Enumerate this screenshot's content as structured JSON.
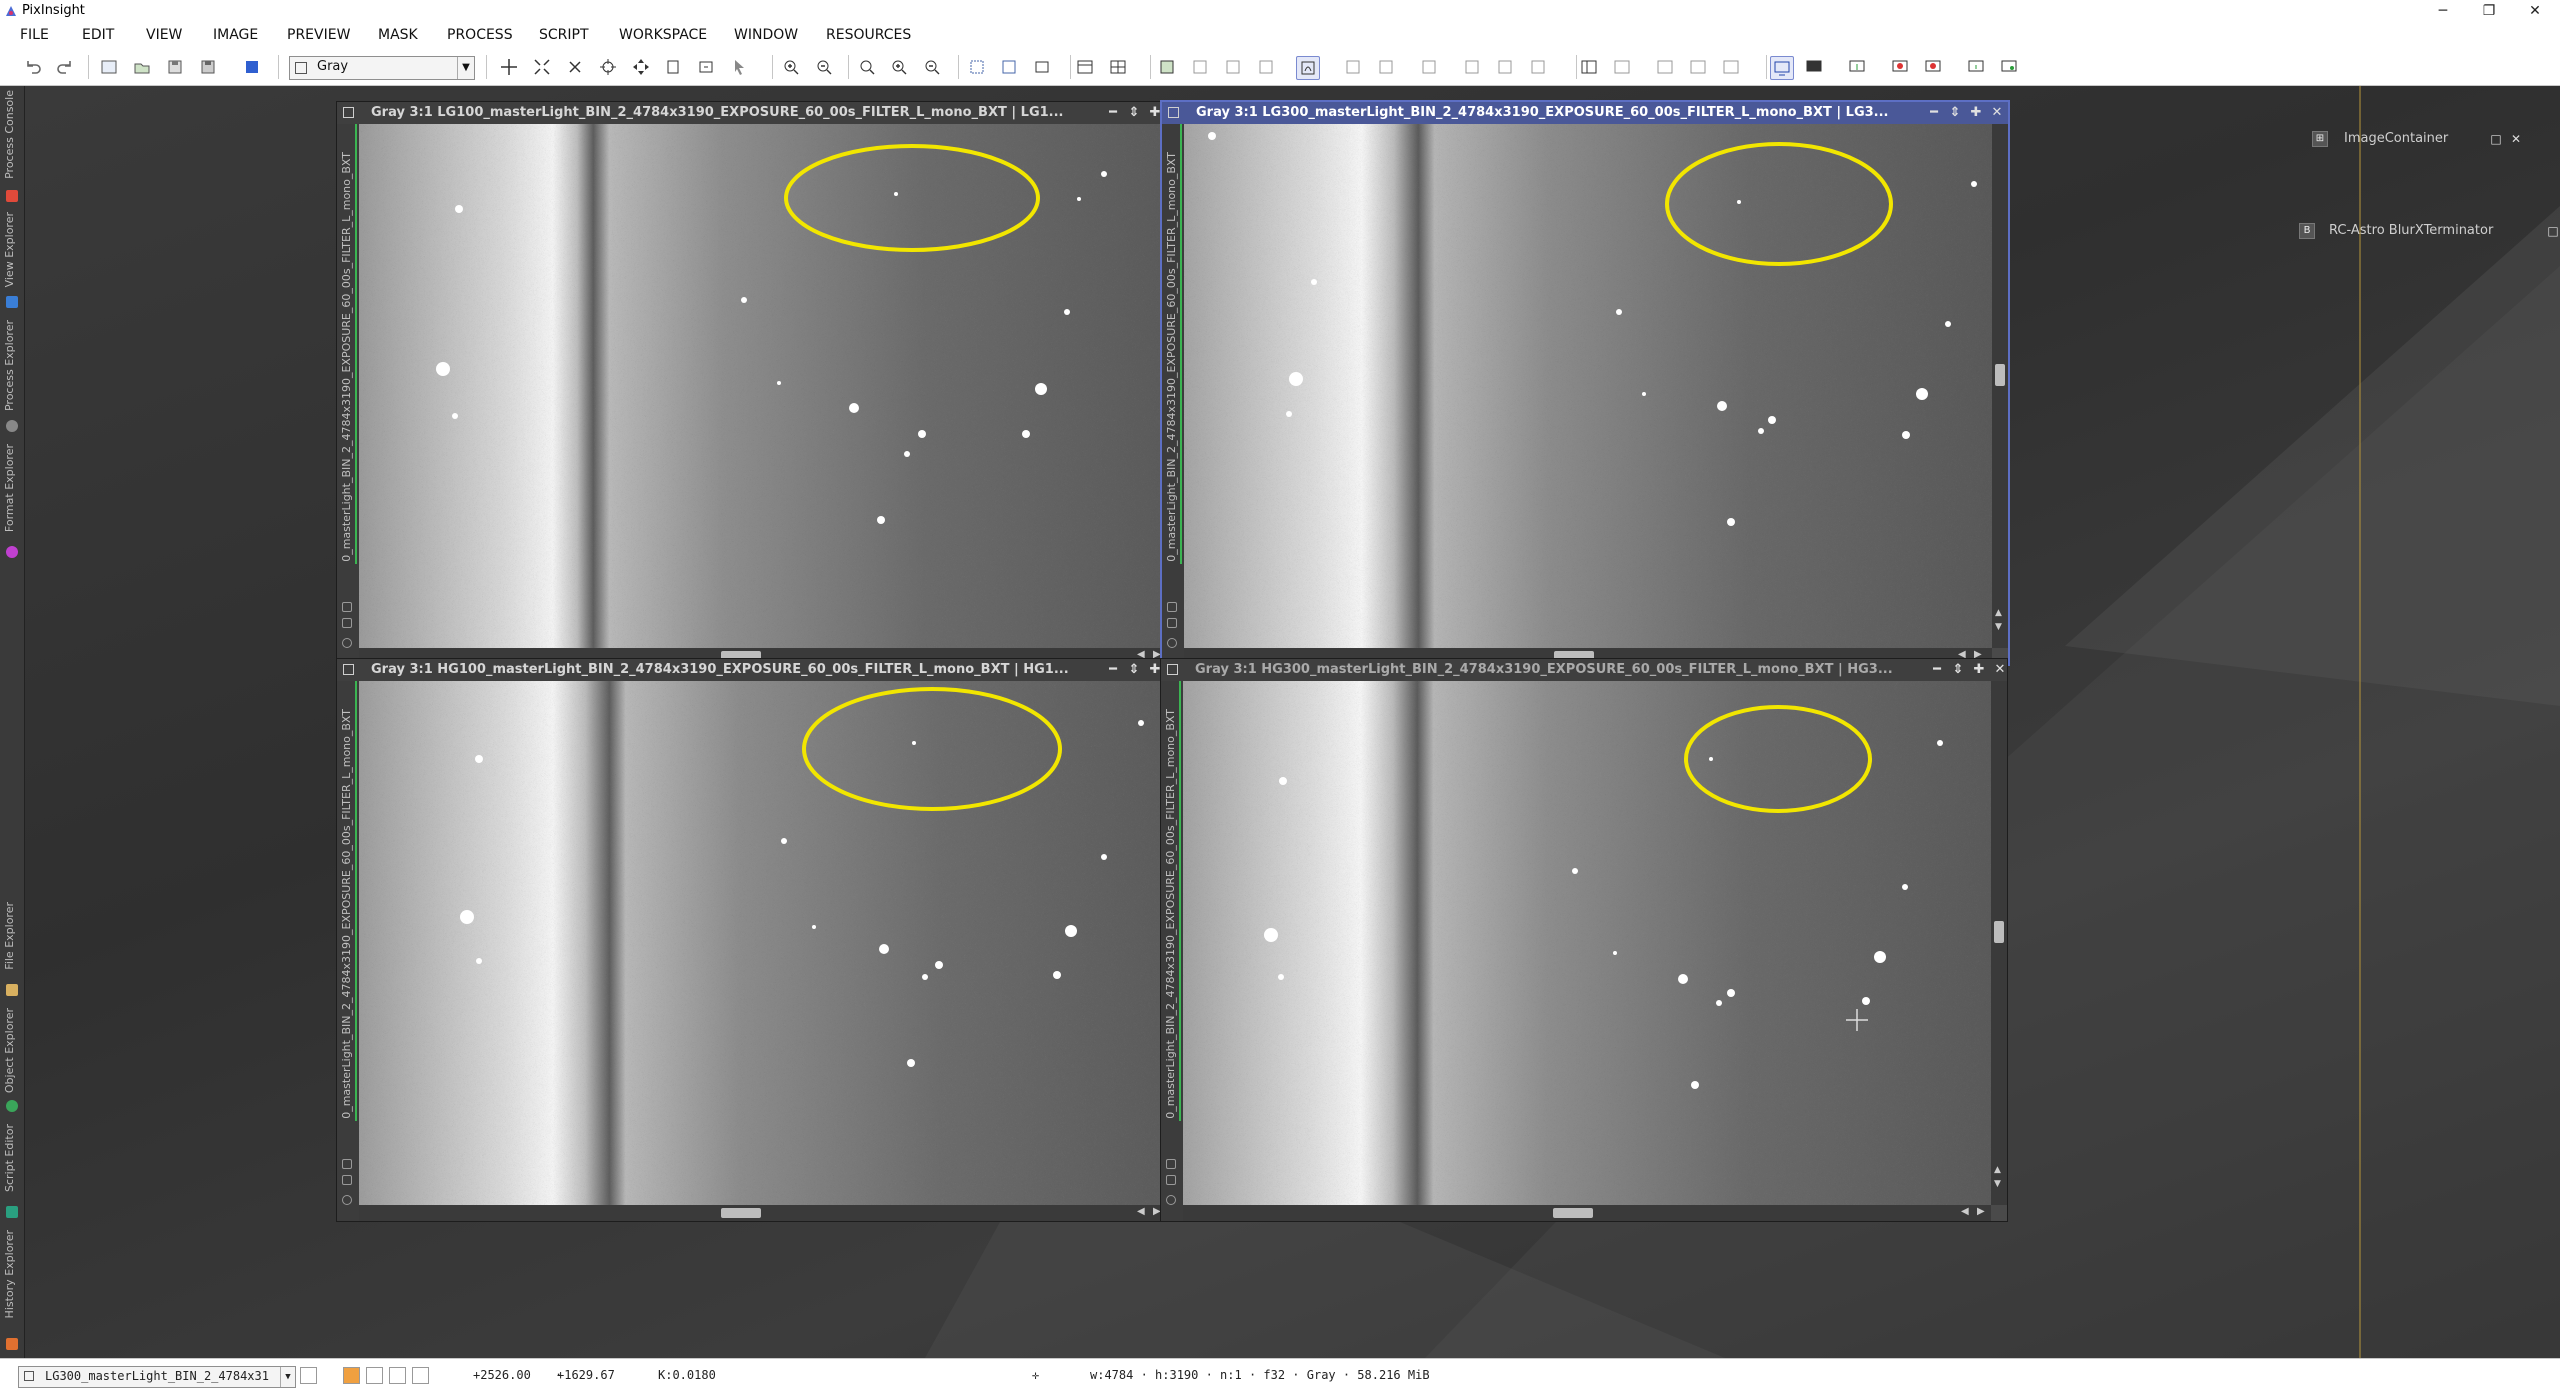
{
  "app": {
    "title": "PixInsight"
  },
  "menu": [
    "FILE",
    "EDIT",
    "VIEW",
    "IMAGE",
    "PREVIEW",
    "MASK",
    "PROCESS",
    "SCRIPT",
    "WORKSPACE",
    "WINDOW",
    "RESOURCES"
  ],
  "toolbar": {
    "colorspace": "Gray"
  },
  "left_dock": [
    "Process Console",
    "View Explorer",
    "Process Explorer",
    "Format Explorer",
    "File Explorer",
    "Object Explorer",
    "Script Editor",
    "History Explorer"
  ],
  "windows": [
    {
      "title": "Gray 3:1 LG100_masterLight_BIN_2_4784x3190_EXPOSURE_60_00s_FILTER_L_mono_BXT | LG1...",
      "side_id": "0_masterLight_BIN_2_4784x3190_EXPOSURE_60_00s_FILTER_L_mono_BXT",
      "active": false
    },
    {
      "title": "Gray 3:1 LG300_masterLight_BIN_2_4784x3190_EXPOSURE_60_00s_FILTER_L_mono_BXT | LG3...",
      "side_id": "0_masterLight_BIN_2_4784x3190_EXPOSURE_60_00s_FILTER_L_mono_BXT",
      "active": true
    },
    {
      "title": "Gray 3:1 HG100_masterLight_BIN_2_4784x3190_EXPOSURE_60_00s_FILTER_L_mono_BXT | HG1...",
      "side_id": "0_masterLight_BIN_2_4784x3190_EXPOSURE_60_00s_FILTER_L_mono_BXT",
      "active": false
    },
    {
      "title": "Gray 3:1 HG300_masterLight_BIN_2_4784x3190_EXPOSURE_60_00s_FILTER_L_mono_BXT | HG3...",
      "side_id": "0_masterLight_BIN_2_4784x3190_EXPOSURE_60_00s_FILTER_L_mono_BXT",
      "active": false
    }
  ],
  "workspace_icons": [
    {
      "label": "ImageContainer",
      "glyph": "⊞"
    },
    {
      "label": "RC-Astro BlurXTerminator",
      "glyph": "B"
    }
  ],
  "status": {
    "view": "LG300_masterLight_BIN_2_4784x3190_EXPOSURE_60_00s_FILTER_L_mono_BXT",
    "view_short": "LG300_masterLight_BIN_2_4784x31",
    "x": "+2526.00",
    "y": "+1629.67",
    "k": "K:0.0180",
    "info": "w:4784 · h:3190 · n:1 · f32 · Gray · 58.216 MiB"
  },
  "colors": {
    "accent": "#4a5898",
    "annotation": "#f2e600",
    "green_bar": "#3bb552"
  }
}
